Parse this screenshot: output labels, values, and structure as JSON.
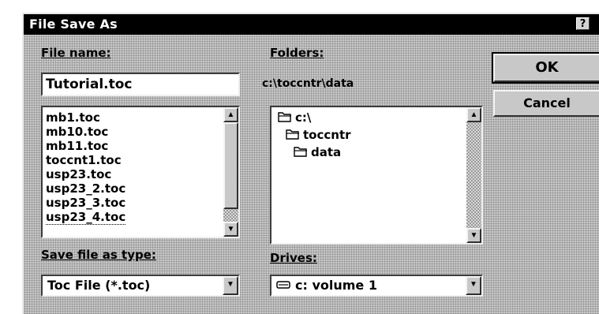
{
  "window": {
    "title": "File Save As",
    "help_label": "?"
  },
  "file_name": {
    "label": "File name:",
    "value": "Tutorial.toc"
  },
  "files": [
    "mb1.toc",
    "mb10.toc",
    "mb11.toc",
    "toccnt1.toc",
    "usp23.toc",
    "usp23_2.toc",
    "usp23_3.toc",
    "usp23_4.toc"
  ],
  "folders": {
    "label": "Folders:",
    "current_path": "c:\\toccntr\\data",
    "tree": [
      "c:\\",
      "toccntr",
      "data"
    ]
  },
  "save_type": {
    "label": "Save file as type:",
    "value": "Toc  File (*.toc)"
  },
  "drives": {
    "label": "Drives:",
    "value": "c: volume 1"
  },
  "buttons": {
    "ok": "OK",
    "cancel": "Cancel"
  },
  "icons": {
    "scroll_up": "scroll-up-arrow-icon",
    "scroll_down": "scroll-down-arrow-icon",
    "dropdown": "chevron-down-icon",
    "folder_open": "open-folder-icon",
    "drive": "hard-drive-icon"
  }
}
